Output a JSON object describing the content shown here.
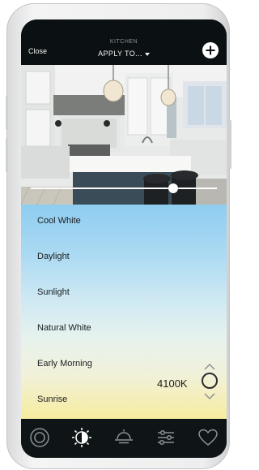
{
  "header": {
    "close_label": "Close",
    "room_label": "KITCHEN",
    "apply_label": "APPLY TO...",
    "add_icon": "plus-icon"
  },
  "photo": {
    "description_icon": "room-photo",
    "brightness_level": 0.78
  },
  "temperatures": {
    "items": [
      "Cool White",
      "Daylight",
      "Sunlight",
      "Natural White",
      "Early Morning",
      "Sunrise"
    ],
    "selected_index": 4,
    "selected_value": "4100K"
  },
  "tabs": [
    {
      "icon": "scene-circle-icon",
      "active": false
    },
    {
      "icon": "color-temperature-icon",
      "active": true
    },
    {
      "icon": "sunrise-icon",
      "active": false
    },
    {
      "icon": "sliders-icon",
      "active": false
    },
    {
      "icon": "heart-icon",
      "active": false
    }
  ],
  "colors": {
    "top_gradient": "#8fcdf0",
    "bottom_gradient": "#f6ec9f",
    "bar_bg": "#0f1416"
  }
}
